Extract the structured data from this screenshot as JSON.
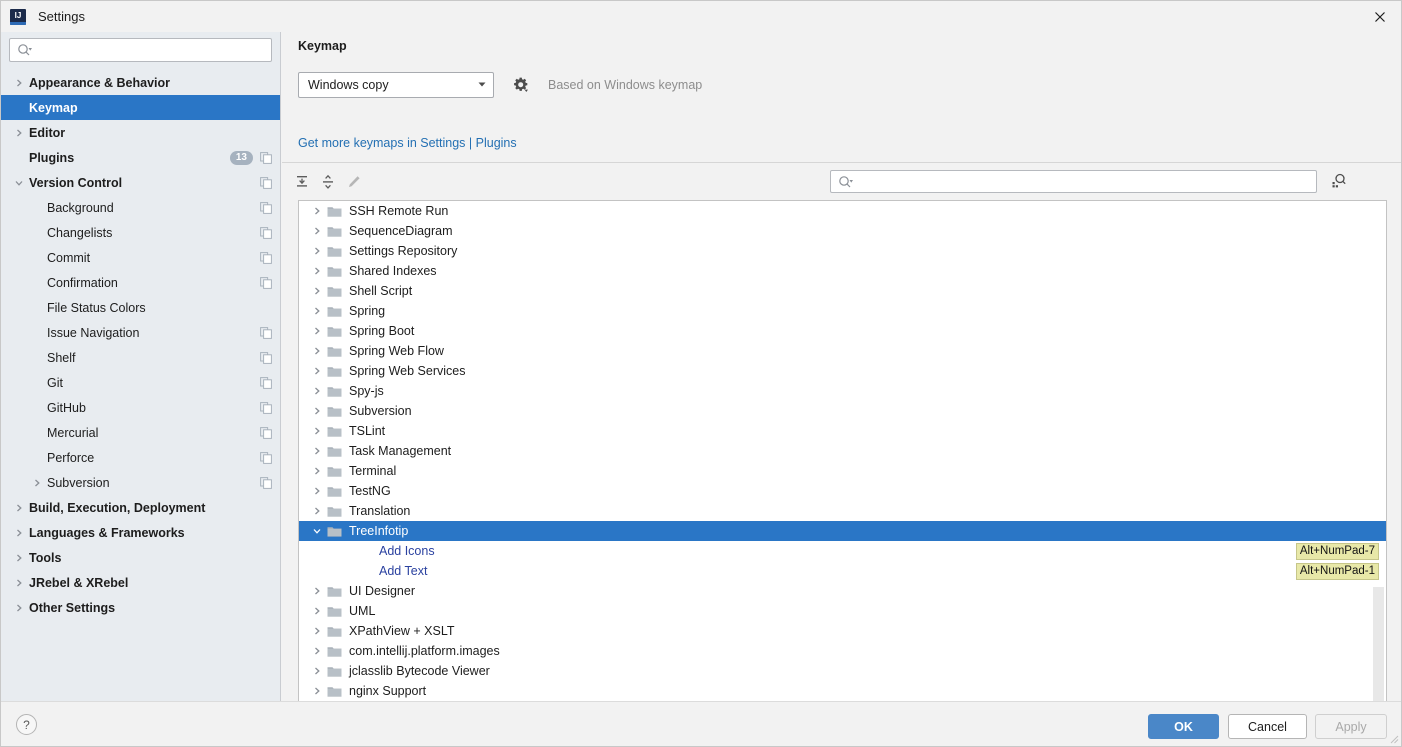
{
  "window": {
    "title": "Settings",
    "logo_text": "IJ",
    "close_icon": "close-icon"
  },
  "sidebar": {
    "search": {
      "placeholder": "",
      "value": "",
      "icon": "search-dropdown-icon"
    },
    "items": [
      {
        "label": "Appearance & Behavior",
        "level": 0,
        "chevron": "right",
        "bold": true,
        "badge": null,
        "copy": false
      },
      {
        "label": "Keymap",
        "level": 0,
        "chevron": "none",
        "bold": true,
        "badge": null,
        "copy": false,
        "selected": true
      },
      {
        "label": "Editor",
        "level": 0,
        "chevron": "right",
        "bold": true,
        "badge": null,
        "copy": false
      },
      {
        "label": "Plugins",
        "level": 0,
        "chevron": "none",
        "bold": true,
        "badge": "13",
        "copy": true
      },
      {
        "label": "Version Control",
        "level": 0,
        "chevron": "down",
        "bold": true,
        "badge": null,
        "copy": true
      },
      {
        "label": "Background",
        "level": 1,
        "chevron": "none",
        "bold": false,
        "badge": null,
        "copy": true
      },
      {
        "label": "Changelists",
        "level": 1,
        "chevron": "none",
        "bold": false,
        "badge": null,
        "copy": true
      },
      {
        "label": "Commit",
        "level": 1,
        "chevron": "none",
        "bold": false,
        "badge": null,
        "copy": true
      },
      {
        "label": "Confirmation",
        "level": 1,
        "chevron": "none",
        "bold": false,
        "badge": null,
        "copy": true
      },
      {
        "label": "File Status Colors",
        "level": 1,
        "chevron": "none",
        "bold": false,
        "badge": null,
        "copy": false
      },
      {
        "label": "Issue Navigation",
        "level": 1,
        "chevron": "none",
        "bold": false,
        "badge": null,
        "copy": true
      },
      {
        "label": "Shelf",
        "level": 1,
        "chevron": "none",
        "bold": false,
        "badge": null,
        "copy": true
      },
      {
        "label": "Git",
        "level": 1,
        "chevron": "none",
        "bold": false,
        "badge": null,
        "copy": true
      },
      {
        "label": "GitHub",
        "level": 1,
        "chevron": "none",
        "bold": false,
        "badge": null,
        "copy": true
      },
      {
        "label": "Mercurial",
        "level": 1,
        "chevron": "none",
        "bold": false,
        "badge": null,
        "copy": true
      },
      {
        "label": "Perforce",
        "level": 1,
        "chevron": "none",
        "bold": false,
        "badge": null,
        "copy": true
      },
      {
        "label": "Subversion",
        "level": 1,
        "chevron": "right",
        "bold": false,
        "badge": null,
        "copy": true
      },
      {
        "label": "Build, Execution, Deployment",
        "level": 0,
        "chevron": "right",
        "bold": true,
        "badge": null,
        "copy": false
      },
      {
        "label": "Languages & Frameworks",
        "level": 0,
        "chevron": "right",
        "bold": true,
        "badge": null,
        "copy": false
      },
      {
        "label": "Tools",
        "level": 0,
        "chevron": "right",
        "bold": true,
        "badge": null,
        "copy": false
      },
      {
        "label": "JRebel & XRebel",
        "level": 0,
        "chevron": "right",
        "bold": true,
        "badge": null,
        "copy": false
      },
      {
        "label": "Other Settings",
        "level": 0,
        "chevron": "right",
        "bold": true,
        "badge": null,
        "copy": false
      }
    ]
  },
  "main": {
    "title": "Keymap",
    "keymap_select": {
      "value": "Windows copy",
      "icon": "chevron-down-icon"
    },
    "gear_icon": "gear-dropdown-icon",
    "based_on": "Based on Windows keymap",
    "get_more_link": "Get more keymaps in Settings | Plugins",
    "toolbar": {
      "expand_all": "expand-all-icon",
      "collapse_all": "collapse-all-icon",
      "edit": "edit-pencil-icon",
      "search": {
        "placeholder": "",
        "value": "",
        "icon": "search-dropdown-icon"
      },
      "find_by_shortcut": "find-by-shortcut-icon"
    },
    "tree": [
      {
        "label": "SSH Remote Run",
        "type": "folder",
        "chevron": "right",
        "shortcut": null
      },
      {
        "label": "SequenceDiagram",
        "type": "folder",
        "chevron": "right",
        "shortcut": null
      },
      {
        "label": "Settings Repository",
        "type": "folder",
        "chevron": "right",
        "shortcut": null
      },
      {
        "label": "Shared Indexes",
        "type": "folder",
        "chevron": "right",
        "shortcut": null
      },
      {
        "label": "Shell Script",
        "type": "folder",
        "chevron": "right",
        "shortcut": null
      },
      {
        "label": "Spring",
        "type": "folder",
        "chevron": "right",
        "shortcut": null
      },
      {
        "label": "Spring Boot",
        "type": "folder",
        "chevron": "right",
        "shortcut": null
      },
      {
        "label": "Spring Web Flow",
        "type": "folder",
        "chevron": "right",
        "shortcut": null
      },
      {
        "label": "Spring Web Services",
        "type": "folder",
        "chevron": "right",
        "shortcut": null
      },
      {
        "label": "Spy-js",
        "type": "folder",
        "chevron": "right",
        "shortcut": null
      },
      {
        "label": "Subversion",
        "type": "folder",
        "chevron": "right",
        "shortcut": null
      },
      {
        "label": "TSLint",
        "type": "folder",
        "chevron": "right",
        "shortcut": null
      },
      {
        "label": "Task Management",
        "type": "folder",
        "chevron": "right",
        "shortcut": null
      },
      {
        "label": "Terminal",
        "type": "folder",
        "chevron": "right",
        "shortcut": null
      },
      {
        "label": "TestNG",
        "type": "folder",
        "chevron": "right",
        "shortcut": null
      },
      {
        "label": "Translation",
        "type": "folder",
        "chevron": "right",
        "shortcut": null
      },
      {
        "label": "TreeInfotip",
        "type": "folder",
        "chevron": "down",
        "shortcut": null,
        "selected": true
      },
      {
        "label": "Add Icons",
        "type": "action",
        "chevron": "none",
        "shortcut": "Alt+NumPad-7"
      },
      {
        "label": "Add Text",
        "type": "action",
        "chevron": "none",
        "shortcut": "Alt+NumPad-1"
      },
      {
        "label": "UI Designer",
        "type": "folder",
        "chevron": "right",
        "shortcut": null
      },
      {
        "label": "UML",
        "type": "folder",
        "chevron": "right",
        "shortcut": null
      },
      {
        "label": "XPathView + XSLT",
        "type": "folder",
        "chevron": "right",
        "shortcut": null
      },
      {
        "label": "com.intellij.platform.images",
        "type": "folder",
        "chevron": "right",
        "shortcut": null
      },
      {
        "label": "jclasslib Bytecode Viewer",
        "type": "folder",
        "chevron": "right",
        "shortcut": null
      },
      {
        "label": "nginx Support",
        "type": "folder",
        "chevron": "right",
        "shortcut": null
      }
    ]
  },
  "footer": {
    "help_label": "?",
    "ok_label": "OK",
    "cancel_label": "Cancel",
    "apply_label": "Apply"
  },
  "colors": {
    "selection_blue": "#2a76c6",
    "link_blue": "#2470b3",
    "action_blue": "#2b42a0",
    "shortcut_bg": "#e8e8a8",
    "ok_button": "#4a87c8",
    "sidebar_bg": "#e8ecf0"
  }
}
